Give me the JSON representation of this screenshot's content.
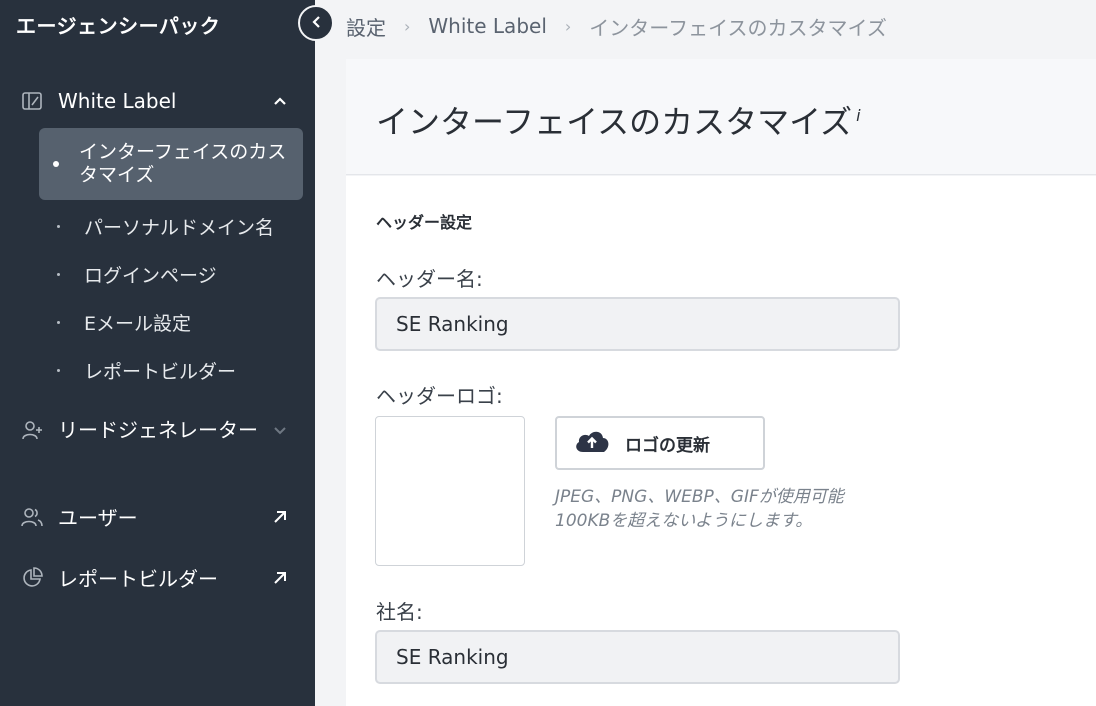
{
  "sidebar": {
    "brand": "エージェンシーパック",
    "items": [
      {
        "label": "White Label"
      },
      {
        "label": "リードジェネレーター"
      },
      {
        "label": "ユーザー"
      },
      {
        "label": "レポートビルダー"
      }
    ],
    "white_label_sub": [
      {
        "label": "インターフェイスのカスタマイズ"
      },
      {
        "label": "パーソナルドメイン名"
      },
      {
        "label": "ログインページ"
      },
      {
        "label": "Eメール設定"
      },
      {
        "label": "レポートビルダー"
      }
    ]
  },
  "breadcrumb": {
    "items": [
      "設定",
      "White Label",
      "インターフェイスのカスタマイズ"
    ]
  },
  "page": {
    "title": "インターフェイスのカスタマイズ",
    "info_marker": "i"
  },
  "form": {
    "section_title": "ヘッダー設定",
    "header_name_label": "ヘッダー名:",
    "header_name_value": "SE Ranking",
    "header_logo_label": "ヘッダーロゴ:",
    "upload_button": "ロゴの更新",
    "hint_line1": "JPEG、PNG、WEBP、GIFが使用可能",
    "hint_line2": "100KBを超えないようにします。",
    "company_label": "社名:",
    "company_value": "SE Ranking"
  },
  "colors": {
    "sidebar_bg": "#28313d",
    "active_item_bg": "#56616e",
    "page_bg": "#f3f4f6"
  }
}
